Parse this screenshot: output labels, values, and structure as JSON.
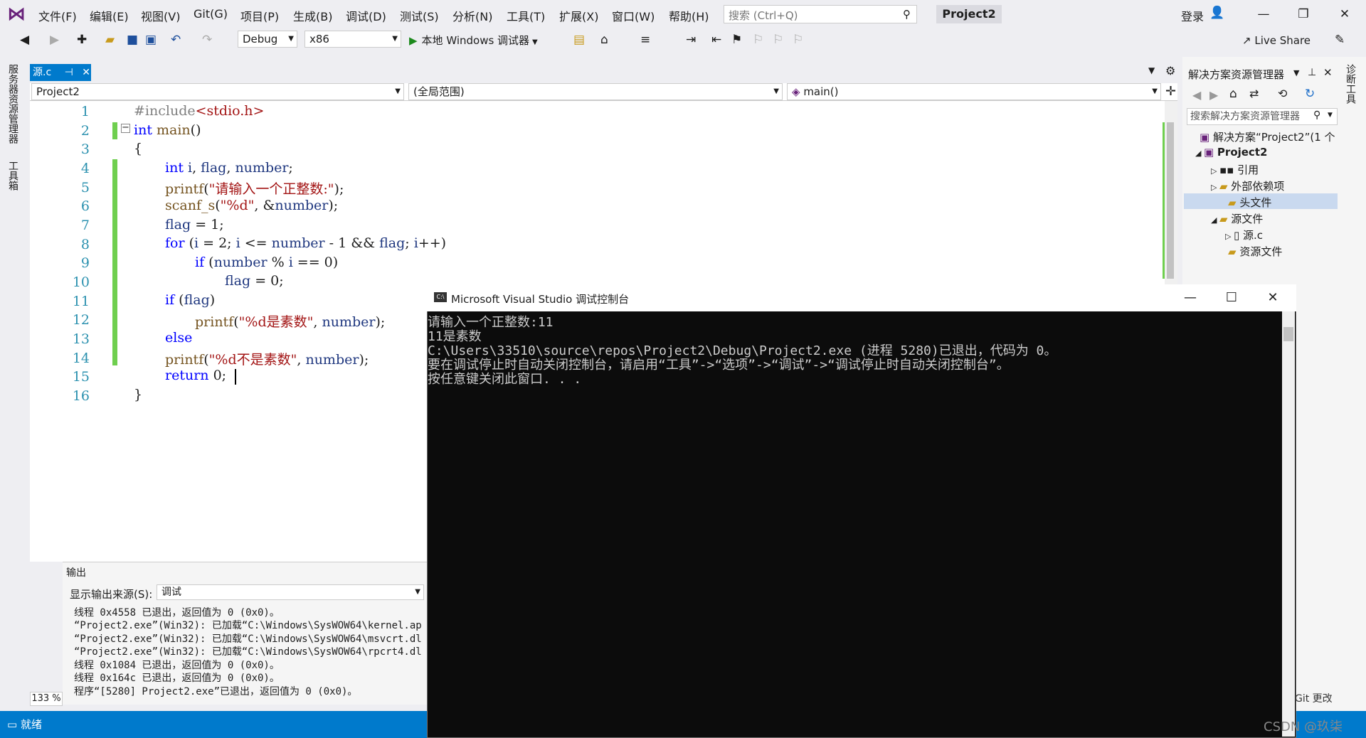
{
  "menu": {
    "items": [
      "文件(F)",
      "编辑(E)",
      "视图(V)",
      "Git(G)",
      "项目(P)",
      "生成(B)",
      "调试(D)",
      "测试(S)",
      "分析(N)",
      "工具(T)",
      "扩展(X)",
      "窗口(W)",
      "帮助(H)"
    ],
    "search_placeholder": "搜索 (Ctrl+Q)",
    "project_name": "Project2",
    "login": "登录"
  },
  "toolbar": {
    "config": "Debug",
    "platform": "x86",
    "run_label": "本地 Windows 调试器",
    "live_share": "Live Share"
  },
  "left_strip": {
    "server_explorer": "服务器资源管理器",
    "toolbox": "工具箱"
  },
  "editor": {
    "tab_label": "源.c",
    "nav_project": "Project2",
    "nav_scope": "(全局范围)",
    "nav_function": "main()",
    "line_numbers": [
      "1",
      "2",
      "3",
      "4",
      "5",
      "6",
      "7",
      "8",
      "9",
      "10",
      "11",
      "12",
      "13",
      "14",
      "15",
      "16"
    ]
  },
  "output": {
    "title": "输出",
    "source_label": "显示输出来源(S):",
    "source_value": "调试",
    "lines": [
      "线程 0x4558 已退出，返回值为 0 (0x0)。",
      "“Project2.exe”(Win32): 已加载“C:\\Windows\\SysWOW64\\kernel.ap",
      "“Project2.exe”(Win32): 已加载“C:\\Windows\\SysWOW64\\msvcrt.dl",
      "“Project2.exe”(Win32): 已加载“C:\\Windows\\SysWOW64\\rpcrt4.dl",
      "线程 0x1084 已退出，返回值为 0 (0x0)。",
      "线程 0x164c 已退出，返回值为 0 (0x0)。",
      "程序“[5280] Project2.exe”已退出，返回值为 0 (0x0)。"
    ],
    "zoom": "133 %"
  },
  "statusbar": {
    "status": "就绪"
  },
  "solution_explorer": {
    "title": "解决方案资源管理器",
    "search_placeholder": "搜索解决方案资源管理器",
    "solution": "解决方案“Project2”(1 个项",
    "project": "Project2",
    "references": "引用",
    "external_deps": "外部依赖项",
    "header_files": "头文件",
    "source_files": "源文件",
    "source_c": "源.c",
    "resource_files": "资源文件",
    "diag_tools": "诊断工具",
    "git_changes": "Git 更改"
  },
  "console": {
    "title": "Microsoft Visual Studio 调试控制台",
    "lines": [
      "请输入一个正整数:11",
      "11是素数",
      "C:\\Users\\33510\\source\\repos\\Project2\\Debug\\Project2.exe (进程 5280)已退出，代码为 0。",
      "要在调试停止时自动关闭控制台，请启用“工具”->“选项”->“调试”->“调试停止时自动关闭控制台”。",
      "按任意键关闭此窗口. . ."
    ]
  },
  "watermark": "CSDN @玖柒"
}
